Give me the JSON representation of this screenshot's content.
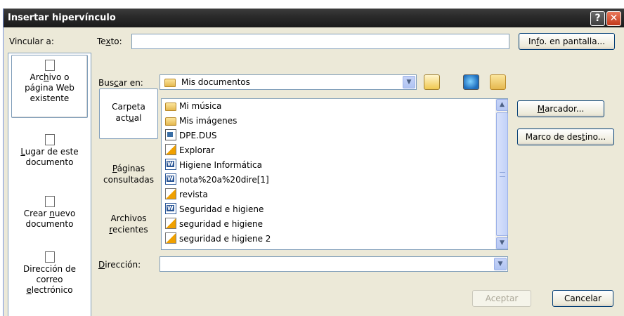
{
  "window": {
    "title": "Insertar hipervínculo",
    "help": "?",
    "close": "✕"
  },
  "vincular_label": "Vincular a:",
  "texto": {
    "label_pre": "Te",
    "label_u": "x",
    "label_post": "to:",
    "value": ""
  },
  "info_button": {
    "pre": "In",
    "u": "f",
    "post": "o. en pantalla..."
  },
  "link_targets": [
    {
      "line1_pre": "Arc",
      "line1_u": "h",
      "line1_post": "ivo o",
      "line2": "página Web",
      "line3": "existente"
    },
    {
      "line1_pre": "",
      "line1_u": "L",
      "line1_post": "ugar de este",
      "line2": "documento",
      "line3": ""
    },
    {
      "line1_pre": "Crear ",
      "line1_u": "n",
      "line1_post": "uevo",
      "line2": "documento",
      "line3": ""
    },
    {
      "line1": "Dirección de",
      "line2": "correo",
      "line3_u": "e",
      "line3_post": "lectrónico"
    }
  ],
  "buscar": {
    "pre": "Bus",
    "u": "c",
    "post": "ar en:",
    "value": "Mis documentos"
  },
  "sub_panel": [
    {
      "line1": "Carpeta",
      "line2_pre": "act",
      "line2_u": "u",
      "line2_post": "al"
    },
    {
      "line1_u": "P",
      "line1_post": "áginas",
      "line2": "consultadas"
    },
    {
      "line1": "Archivos",
      "line2_u": "r",
      "line2_post": "ecientes"
    }
  ],
  "files": [
    {
      "name": "Mi música",
      "icon": "music-folder"
    },
    {
      "name": "Mis imágenes",
      "icon": "pictures-folder"
    },
    {
      "name": "DPE.DUS",
      "icon": "config-file"
    },
    {
      "name": "Explorar",
      "icon": "shortcut-file"
    },
    {
      "name": "Higiene Informática",
      "icon": "word-document"
    },
    {
      "name": "nota%20a%20dire[1]",
      "icon": "word-document"
    },
    {
      "name": "revista",
      "icon": "shortcut-file"
    },
    {
      "name": "Seguridad e higiene",
      "icon": "word-document"
    },
    {
      "name": "seguridad e higiene",
      "icon": "shortcut-file"
    },
    {
      "name": "seguridad e higiene 2",
      "icon": "shortcut-file"
    }
  ],
  "marcador_button": {
    "u": "M",
    "post": "arcador..."
  },
  "marco_button": {
    "pre": "Marco de des",
    "u": "t",
    "post": "ino..."
  },
  "direccion": {
    "u": "D",
    "post": "irección:",
    "value": ""
  },
  "aceptar": "Aceptar",
  "cancelar": "Cancelar"
}
